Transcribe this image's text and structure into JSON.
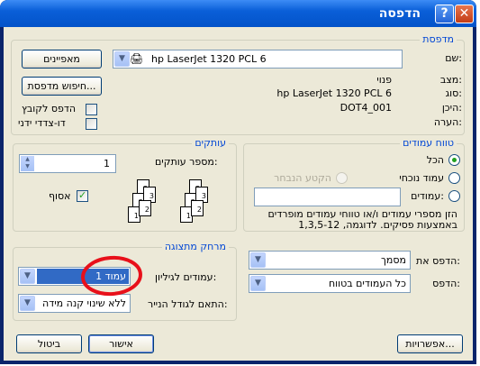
{
  "window": {
    "title": "הדפסה",
    "help_glyph": "?",
    "close_glyph": "✕"
  },
  "printer": {
    "group_label": "מדפסת",
    "name_label": "שם:",
    "name_value": "hp LaserJet 1320 PCL 6",
    "properties_button": "מאפיינים",
    "status_label": "מצב:",
    "status_value": "פנוי",
    "type_label": "סוג:",
    "type_value": "hp LaserJet 1320 PCL 6",
    "where_label": "היכן:",
    "where_value": "DOT4_001",
    "comment_label": "הערה:",
    "find_printer_button": "חיפוש מדפסת...",
    "print_to_file": "הדפס לקובץ",
    "manual_duplex": "דו-צדדי ידני"
  },
  "page_range": {
    "group_label": "טווח עמודים",
    "all": "הכל",
    "current_page": "עמוד נוכחי",
    "selection": "הקטע הנבחר",
    "pages": "עמודים:",
    "pages_value": "",
    "hint": "הזן מספרי עמודים ו/או טווחי עמודים מופרדים באמצעות פסיקים. לדוגמה, 1,3,5-12"
  },
  "copies": {
    "group_label": "עותקים",
    "count_label": "מספר עותקים:",
    "count_value": "1",
    "collate": "אסוף",
    "page_numbers": [
      "1",
      "2",
      "3"
    ]
  },
  "print_what": {
    "label": "הדפס את:",
    "value": "מסמך"
  },
  "print": {
    "label": "הדפס:",
    "value": "כל העמודים בטווח"
  },
  "zoom": {
    "group_label": "מרחק מתצוגה",
    "pages_per_sheet_label": "עמודים לגיליון:",
    "pages_per_sheet_value": "עמוד 1",
    "scale_label": "התאם לגודל הנייר:",
    "scale_value": "ללא שינוי קנה מידה"
  },
  "buttons": {
    "options": "אפשרויות...",
    "ok": "אישור",
    "cancel": "ביטול"
  },
  "annotation": {
    "color": "#e8101a"
  }
}
